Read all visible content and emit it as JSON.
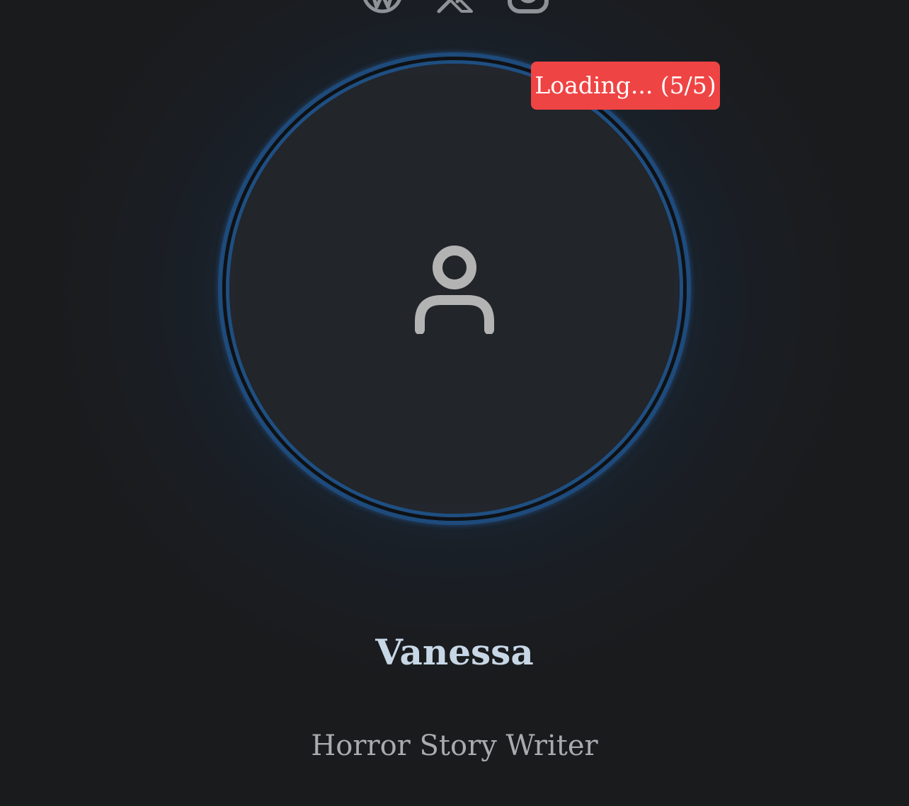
{
  "social": {
    "icons": [
      "wordpress-icon",
      "x-icon",
      "instagram-icon"
    ]
  },
  "avatar": {
    "icon": "user-icon",
    "ring_color": "#1e4b7c",
    "fill_color": "#23262c"
  },
  "loading": {
    "label": "Loading... (5/5)",
    "color": "#ef4444"
  },
  "profile": {
    "name": "Vanessa",
    "title": "Horror Story Writer"
  }
}
